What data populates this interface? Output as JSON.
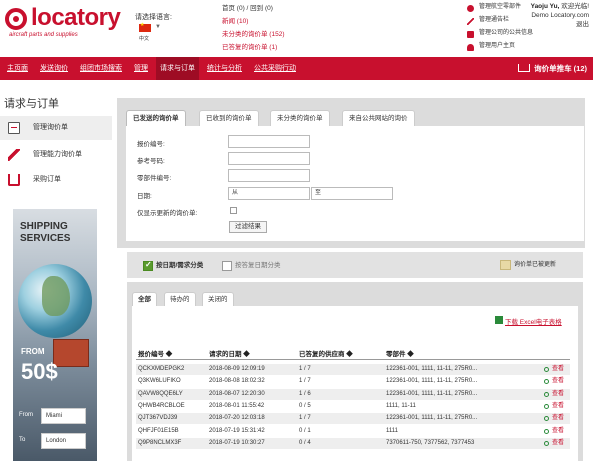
{
  "brand": {
    "name": "locatory",
    "tagline": "aircraft parts and supplies"
  },
  "language": {
    "label": "请选择语言:",
    "selected": "中文"
  },
  "stats": {
    "line1": "首页 (0) / 回到 (0)",
    "line2": "新闻 (10)",
    "line3": "未分类的询价单 (152)",
    "line4": "已答复的询价单 (1)"
  },
  "quick_links": [
    "管理航空零部件",
    "管理通告栏",
    "管理公司的公共信息",
    "管理用户主页"
  ],
  "user": {
    "name": "Yaoju Yu,",
    "greeting": "欢迎光临!",
    "company": "Demo Locatory.com",
    "logout": "退出"
  },
  "nav": {
    "items": [
      "主页面",
      "发送询价",
      "组团市场搜索",
      "管理",
      "请求与订单",
      "统计与分析",
      "公共采购行动"
    ],
    "active_index": 4,
    "cart_label": "询价单推车 (12)"
  },
  "sidebar": {
    "title": "请求与订单",
    "items": [
      "管理询价单",
      "管理能力询价单",
      "采购订单"
    ]
  },
  "ad": {
    "title_line1": "SHIPPING",
    "title_line2": "SERVICES",
    "from_text": "FROM",
    "price": "50$",
    "from_label": "From",
    "from_value": "Miami",
    "to_label": "To",
    "to_value": "London"
  },
  "tabs": [
    "已发送的询价单",
    "已收到的询价单",
    "未分类的询价单",
    "来自公共网站的询价"
  ],
  "form": {
    "rfq_no": "报价编号:",
    "ref_no": "参考号码:",
    "part_no": "零部件编号:",
    "date": "日期:",
    "date_from": "从",
    "date_to": "至",
    "changed_only": "仅显示更新的询价单:",
    "filter_button": "过滤结果"
  },
  "grouping": {
    "option_on": "按日期/需求分类",
    "option_off": "按答复日期分类",
    "legend": "询价单已被更新"
  },
  "result_tabs": [
    "全部",
    "待办的",
    "关闭的"
  ],
  "excel_link": "下载 Excel电子表格",
  "table": {
    "headers": [
      "报价编号 ◆",
      "请求的日期 ◆",
      "已答复的供应商 ◆",
      "零部件 ◆"
    ],
    "view_label": "查看",
    "rows": [
      [
        "QCKXMDEPGK2",
        "2018-08-09 12:09:19",
        "1 / 7",
        "122361-001, 1111, 11-11, 275R0..."
      ],
      [
        "Q3KW6LUFIKO",
        "2018-08-08 18:02:32",
        "1 / 7",
        "122361-001, 1111, 11-11, 275R0..."
      ],
      [
        "QAVW8QQE6LY",
        "2018-08-07 12:20:30",
        "1 / 6",
        "122361-001, 1111, 11-11, 275R0..."
      ],
      [
        "QHWB4RCBLOE",
        "2018-08-01 11:55:42",
        "0 / 5",
        "1111, 11-11"
      ],
      [
        "QJT367VDJ39",
        "2018-07-20 12:03:18",
        "1 / 7",
        "122361-001, 1111, 11-11, 275R0..."
      ],
      [
        "QHFJF01E15B",
        "2018-07-19 15:31:42",
        "0 / 1",
        "1111"
      ],
      [
        "Q9P8NCLMX3F",
        "2018-07-19 10:30:27",
        "0 / 4",
        "7370611-750, 7377562, 7377453"
      ]
    ]
  },
  "colors": {
    "brand_red": "#c8102e",
    "nav_active": "#9e0c24",
    "panel_gray": "#dcdcdc",
    "check_green": "#5a9b2e",
    "updated_swatch": "#e8d9a5"
  }
}
